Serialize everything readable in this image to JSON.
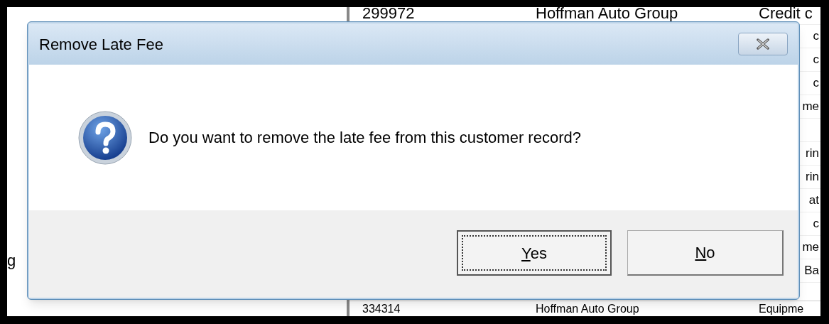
{
  "background_table": {
    "rows": [
      {
        "column_1": "299972",
        "column_2": "Hoffman Auto Group",
        "column_3": "Credit c"
      },
      {
        "column_3": "c"
      },
      {
        "column_3": "c"
      },
      {
        "column_3": "c"
      },
      {
        "column_3": "me"
      },
      {},
      {
        "column_3": "rin"
      },
      {
        "column_3": "rin"
      },
      {
        "column_3": "at"
      },
      {
        "column_3": "c"
      },
      {
        "column_3": "me"
      },
      {
        "column_3": "Ba"
      },
      {
        "column_1": "334314",
        "column_2": "Hoffman Auto Group",
        "column_3": "Equipme"
      }
    ],
    "left_fragment": "g"
  },
  "dialog": {
    "title": "Remove Late Fee",
    "message": "Do you want to remove the late fee from this customer record?",
    "buttons": [
      {
        "label": "Yes",
        "default": true
      },
      {
        "label": "No",
        "default": false
      }
    ]
  }
}
